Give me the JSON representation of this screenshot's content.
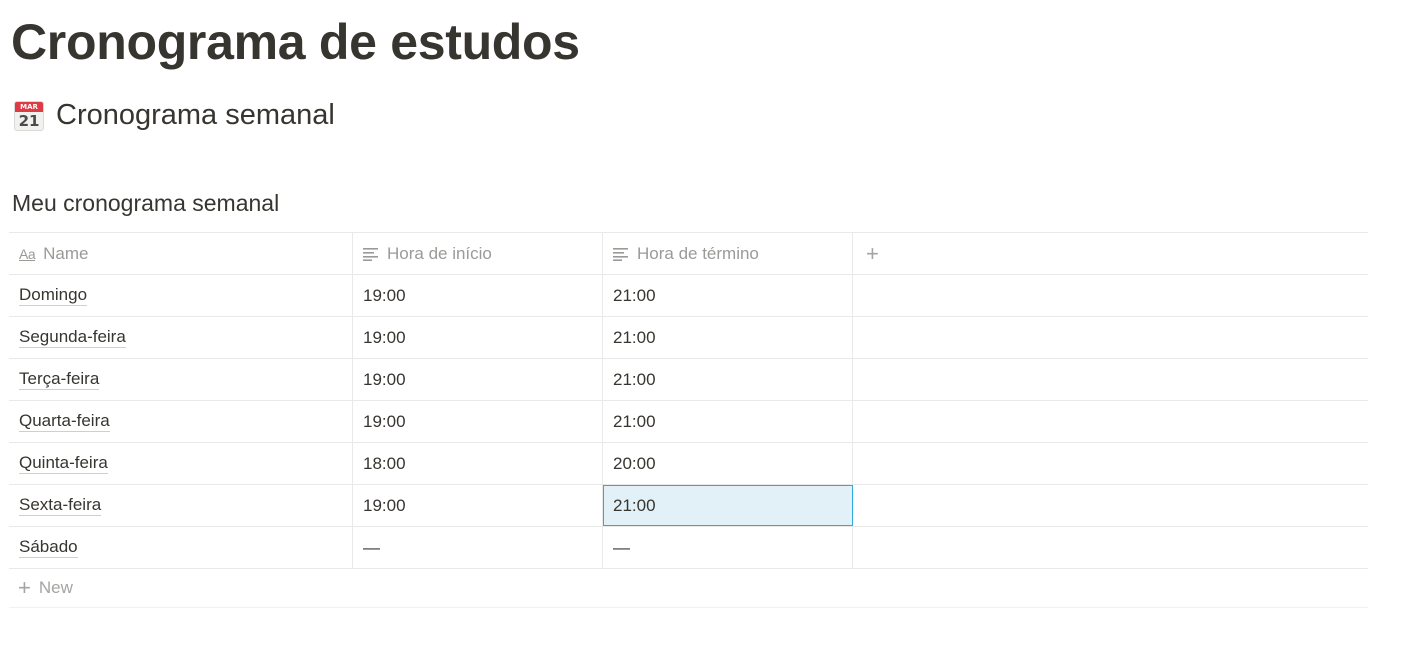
{
  "page": {
    "title": "Cronograma de estudos"
  },
  "section": {
    "icon": "calendar-icon",
    "icon_month": "MAR",
    "icon_day": "21",
    "heading": "Cronograma semanal"
  },
  "database": {
    "title": "Meu cronograma semanal",
    "columns": [
      {
        "label": "Name",
        "icon": "title-property-icon"
      },
      {
        "label": "Hora de início",
        "icon": "text-property-icon"
      },
      {
        "label": "Hora de término",
        "icon": "text-property-icon"
      }
    ],
    "add_column_icon": "plus-icon",
    "rows": [
      {
        "name": "Domingo",
        "start": "19:00",
        "end": "21:00"
      },
      {
        "name": "Segunda-feira",
        "start": "19:00",
        "end": "21:00"
      },
      {
        "name": "Terça-feira",
        "start": "19:00",
        "end": "21:00"
      },
      {
        "name": "Quarta-feira",
        "start": "19:00",
        "end": "21:00"
      },
      {
        "name": "Quinta-feira",
        "start": "18:00",
        "end": "20:00"
      },
      {
        "name": "Sexta-feira",
        "start": "19:00",
        "end": "21:00"
      },
      {
        "name": "Sábado",
        "start": "—",
        "end": "—"
      }
    ],
    "selected_cell": {
      "row": 5,
      "column": "end"
    },
    "new_label": "New"
  },
  "colors": {
    "text": "#37352f",
    "muted": "#9b9a97",
    "border": "#e9e9e7",
    "selection_bg": "#e2f1f8",
    "selection_border": "#2eaadc",
    "calendar_red": "#dd3c44"
  }
}
